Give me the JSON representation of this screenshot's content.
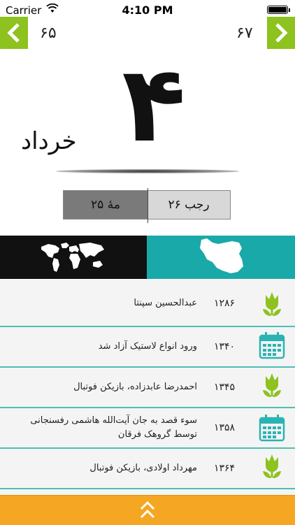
{
  "status": {
    "carrier": "Carrier",
    "time": "4:10 PM"
  },
  "nav": {
    "prev_number": "۶۵",
    "next_number": "۶۷"
  },
  "day": {
    "number": "۴",
    "month": "خرداد"
  },
  "dates": {
    "gregorian": "۲۵ مهٔ",
    "hijri": "۲۶ رجب"
  },
  "tabs": {
    "world": "world-map",
    "iran": "iran-map",
    "active": "iran"
  },
  "events": [
    {
      "text": "عبدالحسین سپنتا",
      "year": "۱۲۸۶",
      "icon": "flower-icon"
    },
    {
      "text": "ورود انواع لاستیک آزاد شد",
      "year": "۱۳۴۰",
      "icon": "calendar-icon"
    },
    {
      "text": "احمدرضا عابدزاده، بازیکن فوتبال",
      "year": "۱۳۴۵",
      "icon": "flower-icon"
    },
    {
      "text": "سوء قصد به جان آیت‌الله هاشمی رفسنجانی توسط گروهک فرقان",
      "year": "۱۳۵۸",
      "icon": "calendar-icon"
    },
    {
      "text": "مهرداد اولادی، بازیکن فوتبال",
      "year": "۱۳۶۴",
      "icon": "flower-icon"
    }
  ],
  "colors": {
    "green": "#8dc21f",
    "teal": "#1aa9a9",
    "orange": "#f5a623"
  }
}
